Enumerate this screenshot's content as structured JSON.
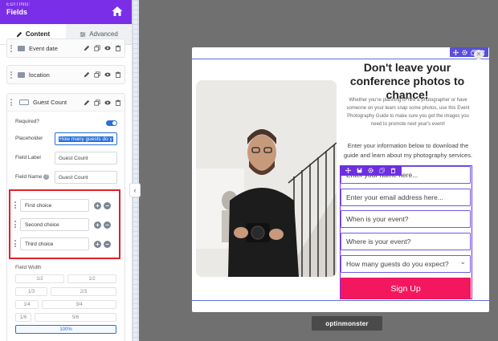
{
  "sidebar": {
    "header": {
      "overline": "EDITING:",
      "title": "Fields"
    },
    "tabs": [
      {
        "label": "Content",
        "active": true
      },
      {
        "label": "Advanced",
        "active": false
      }
    ],
    "fields": [
      {
        "label": "Event date"
      },
      {
        "label": "location"
      }
    ],
    "guest_count": {
      "title": "Guest Count",
      "required_label": "Required?",
      "required": true,
      "placeholder_label": "Placeholder",
      "placeholder_value": "How many guests do y",
      "field_label_label": "Field Label",
      "field_label_value": "Guest Count",
      "field_name_label": "Field Name",
      "field_name_value": "Guest Count",
      "choices": [
        "First choice",
        "Second choice",
        "Third choice"
      ],
      "field_width_label": "Field Width",
      "widths": [
        "1/2",
        "1/2",
        "1/3",
        "2/3",
        "1/4",
        "3/4",
        "1/6",
        "5/6",
        "100%"
      ],
      "active_width": "100%"
    }
  },
  "popup": {
    "headline": "Don't leave your conference photos to chance!",
    "paragraph1": "Whether you're planning to hire a photographer or have someone on your team snap some photos, use this Event Photography Guide to make sure you get the images you need to promote next year's event!",
    "paragraph2": "Enter your information below to download the guide and learn about my photography services.",
    "inputs": [
      {
        "placeholder": "Enter your name here..."
      },
      {
        "placeholder": "Enter your email address here..."
      },
      {
        "placeholder": "When is your event?"
      },
      {
        "placeholder": "Where is your event?"
      },
      {
        "placeholder": "How many guests do you expect?"
      }
    ],
    "signup_label": "Sign Up"
  },
  "brand": "optinmonster",
  "colors": {
    "accent": "#7b2ee8",
    "cta": "#f2175e",
    "highlight": "#e0202a",
    "link": "#2a6fdb"
  }
}
